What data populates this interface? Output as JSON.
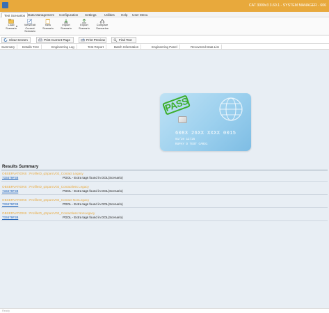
{
  "window": {
    "title": "CAT 3000v3 3.60.1 - SYSTEM MANAGER - 606"
  },
  "menu": {
    "tabs": [
      "Test Scenarios",
      "Data Management",
      "Configuration",
      "Settings",
      "Utilities",
      "Help",
      "User Menu"
    ],
    "active": "Test Scenarios"
  },
  "ribbon": {
    "buttons": [
      {
        "label": "Load\nScenario",
        "icon": "load-icon"
      },
      {
        "label": "View/Edit\nCurrent Scenario",
        "icon": "edit-icon"
      },
      {
        "label": "New\nScenario",
        "icon": "new-icon"
      },
      {
        "label": "Import\nScenario",
        "icon": "import-icon"
      },
      {
        "label": "Export\nScenario",
        "icon": "export-icon"
      },
      {
        "label": "Compare\nScenarios",
        "icon": "compare-icon"
      }
    ]
  },
  "toolbar": {
    "clear_screen": "Clear Screen",
    "print_current_page": "Print Current Page",
    "print_preview": "Print Preview",
    "find_text": "Find Text"
  },
  "view_tabs": [
    "Summary",
    "Details Tree",
    "Engineering Log",
    "Test Report",
    "Batch Information",
    "Engineering Panel",
    "Recovered Data List"
  ],
  "card": {
    "stamp": "PASS",
    "number": "6083 26XX XXXX 0015",
    "expiry": "01/10  12/25",
    "holder": "RUPAY D TEST CARD1",
    "colors": {
      "stamp": "#3cae2c",
      "card": "#9cd0ee"
    }
  },
  "results": {
    "heading": "Results Summary",
    "items": [
      {
        "obs": "OBSERVATIONS : ProfileID_qSparcV02_Contact Legacy",
        "id": "733479F38",
        "message": "PDOL - Extra tags found in DOL(Scenario)"
      },
      {
        "obs": "OBSERVATIONS : ProfileID_qSparcV02_Contactless Legacy",
        "id": "733479F38",
        "message": "PDOL - Extra tags found in DOL(Scenario)"
      },
      {
        "obs": "OBSERVATIONS : ProfileID_qSparcV02_Contact NonLegacy",
        "id": "733479F38",
        "message": "PDOL - Extra tags found in DOL(Scenario)"
      },
      {
        "obs": "OBSERVATIONS : ProfileID_qSparcV02_Contactless NonLegacy",
        "id": "733479F38",
        "message": "PDOL - Extra tags found in DOL(Scenario)"
      }
    ],
    "colors": {
      "observation": "#e8a93c",
      "link": "#1a5fb8"
    }
  },
  "status": {
    "text": "Ready"
  }
}
